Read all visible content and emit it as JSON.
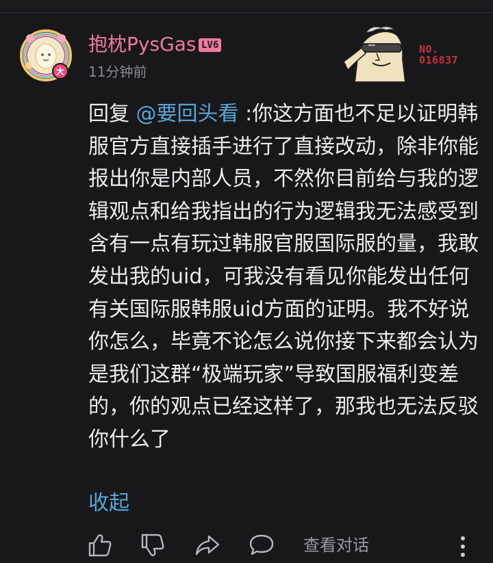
{
  "comment": {
    "username": "抱枕PysGas",
    "level_badge": "LV6",
    "timestamp": "11分钟前",
    "fan_card": {
      "number": "NO.\n016837"
    },
    "reply_prefix": "回复 ",
    "mention": "@要回头看",
    "body": " :你这方面也不足以证明韩服官方直接插手进行了直接改动，除非你能报出你是内部人员，不然你目前给与我的逻辑观点和给我指出的行为逻辑我无法感受到含有一点有玩过韩服官服国际服的量，我敢发出我的uid，可我没有看见你能发出任何有关国际服韩服uid方面的证明。我不好说你怎么，毕竟不论怎么说你接下来都会认为是我们这群“极端玩家”导致国服福利变差的，你的观点已经这样了，那我也无法反驳你什么了",
    "collapse_label": "收起"
  },
  "actions": {
    "view_dialog_label": "查看对话",
    "icons": [
      "thumb-up-icon",
      "thumb-down-icon",
      "share-icon",
      "chat-bubble-icon",
      "more-vertical-icon"
    ]
  },
  "colors": {
    "background": "#18181b",
    "username": "#f07a9c",
    "mention": "#59a5d8",
    "text": "#ececee",
    "muted": "#8a8a90"
  }
}
